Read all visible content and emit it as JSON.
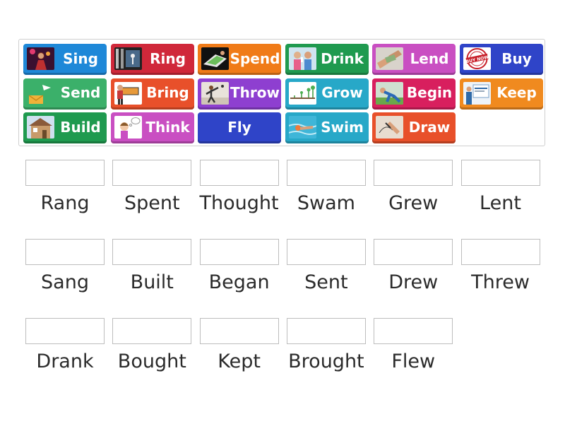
{
  "tiles": [
    {
      "label": "Sing",
      "color": "#1e88d8",
      "icon": "singer-photo-icon"
    },
    {
      "label": "Ring",
      "color": "#d0283a",
      "icon": "ringing-phone-photo-icon"
    },
    {
      "label": "Spend",
      "color": "#f07b18",
      "icon": "spending-money-photo-icon"
    },
    {
      "label": "Drink",
      "color": "#1f9a4f",
      "icon": "children-drinking-photo-icon"
    },
    {
      "label": "Lend",
      "color": "#c94fc2",
      "icon": "handing-money-photo-icon"
    },
    {
      "label": "Buy",
      "color": "#2f44c8",
      "icon": "buy-now-stamp-icon"
    },
    {
      "label": "Send",
      "color": "#3bb06a",
      "icon": "envelope-send-icon"
    },
    {
      "label": "Bring",
      "color": "#e8502a",
      "icon": "man-carrying-box-icon"
    },
    {
      "label": "Throw",
      "color": "#8e3fd0",
      "icon": "person-throwing-photo-icon"
    },
    {
      "label": "Grow",
      "color": "#27a8c8",
      "icon": "growing-seedlings-icon"
    },
    {
      "label": "Begin",
      "color": "#d81f5e",
      "icon": "runner-starting-photo-icon"
    },
    {
      "label": "Keep",
      "color": "#f08a1f",
      "icon": "person-keep-sign-icon"
    },
    {
      "label": "Build",
      "color": "#1f9a4f",
      "icon": "house-building-photo-icon"
    },
    {
      "label": "Think",
      "color": "#c94fc2",
      "icon": "girl-thinking-icon"
    },
    {
      "label": "Fly",
      "color": "#2f44c8",
      "icon": ""
    },
    {
      "label": "Swim",
      "color": "#27a8c8",
      "icon": "swimmer-photo-icon"
    },
    {
      "label": "Draw",
      "color": "#e8502a",
      "icon": "hand-drawing-photo-icon"
    }
  ],
  "answers": [
    "Rang",
    "Spent",
    "Thought",
    "Swam",
    "Grew",
    "Lent",
    "Sang",
    "Built",
    "Began",
    "Sent",
    "Drew",
    "Threw",
    "Drank",
    "Bought",
    "Kept",
    "Brought",
    "Flew"
  ]
}
